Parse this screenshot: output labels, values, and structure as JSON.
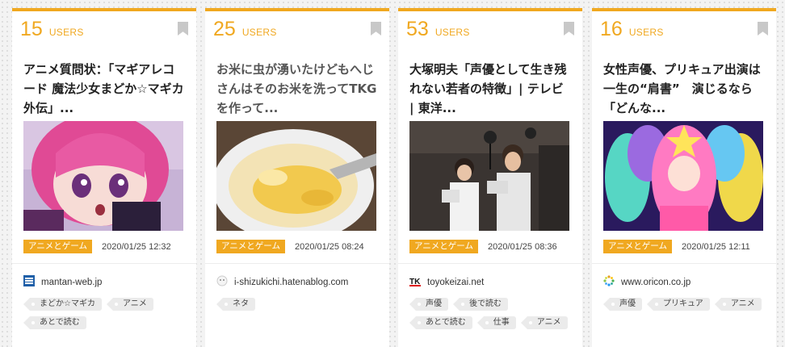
{
  "colors": {
    "accent": "#f0a820",
    "tag_bg": "#ebebeb"
  },
  "cards": [
    {
      "count": "15",
      "count_label": "USERS",
      "title": "アニメ質問状：「マギアレコード 魔法少女まどか☆マギカ外伝」...",
      "category": "アニメとゲーム",
      "date": "2020/01/25 12:32",
      "site": "mantan-web.jp",
      "favicon": "mantan-web-logo-icon",
      "tags": [
        "まどか☆マギカ",
        "アニメ",
        "あとで読む"
      ]
    },
    {
      "count": "25",
      "count_label": "USERS",
      "title": "お米に虫が湧いたけどもへじさんはそのお米を洗ってTKGを作って...",
      "category": "アニメとゲーム",
      "date": "2020/01/25 08:24",
      "site": "i-shizukichi.hatenablog.com",
      "favicon": "hatena-blog-icon",
      "tags": [
        "ネタ"
      ]
    },
    {
      "count": "53",
      "count_label": "USERS",
      "title": "大塚明夫「声優として生き残れない若者の特徴」| テレビ | 東洋...",
      "category": "アニメとゲーム",
      "date": "2020/01/25 08:36",
      "site": "toyokeizai.net",
      "favicon": "toyokeizai-logo-icon",
      "tags": [
        "声優",
        "後で読む",
        "あとで読む",
        "仕事",
        "アニメ"
      ]
    },
    {
      "count": "16",
      "count_label": "USERS",
      "title": "女性声優、プリキュア出演は一生の“肩書”　演じるなら「どんな...",
      "category": "アニメとゲーム",
      "date": "2020/01/25 12:11",
      "site": "www.oricon.co.jp",
      "favicon": "oricon-logo-icon",
      "tags": [
        "声優",
        "プリキュア",
        "アニメ"
      ]
    }
  ]
}
